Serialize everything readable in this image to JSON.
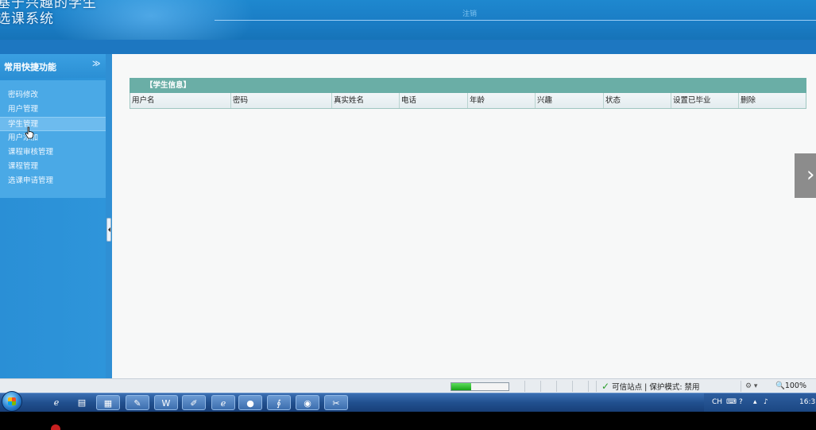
{
  "header": {
    "title_line1": "基于兴趣的学生",
    "title_line2": "选课系统",
    "logout_label": "注销"
  },
  "sidebar": {
    "section_title": "常用快捷功能",
    "collapse_glyph": "≫",
    "items": [
      {
        "label": "密码修改"
      },
      {
        "label": "用户管理"
      },
      {
        "label": "学生管理",
        "active": true
      },
      {
        "label": "用户添加"
      },
      {
        "label": "课程审核管理"
      },
      {
        "label": "课程管理"
      },
      {
        "label": "选课申请管理"
      }
    ]
  },
  "main": {
    "panel_title": "【学生信息】",
    "columns": [
      "用户名",
      "密码",
      "真实姓名",
      "电话",
      "年龄",
      "兴趣",
      "状态",
      "设置已毕业",
      "删除"
    ],
    "next_label": "›"
  },
  "statusbar": {
    "progress_fraction": 0.35,
    "trusted_text": "可信站点 | 保护模式: 禁用",
    "zoom_text": "100%"
  },
  "taskbar": {
    "tray_lang": "CH",
    "clock": "16:3"
  },
  "colors": {
    "header": "#1a7cc4",
    "sidebar": "#2e95da",
    "panel_header": "#6aaea6"
  }
}
